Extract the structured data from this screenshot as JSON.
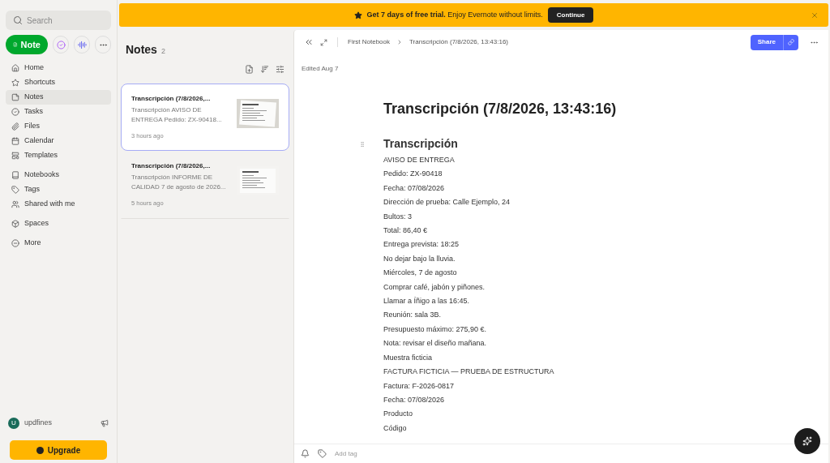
{
  "sidebar": {
    "search": {
      "placeholder": "Search"
    },
    "new_note": "Note",
    "nav_groups": [
      [
        {
          "kind": "home",
          "label": "Home",
          "selected": false
        },
        {
          "kind": "star",
          "label": "Shortcuts",
          "selected": false
        },
        {
          "kind": "note",
          "label": "Notes",
          "selected": true
        },
        {
          "kind": "task",
          "label": "Tasks",
          "selected": false
        },
        {
          "kind": "file",
          "label": "Files",
          "selected": false
        },
        {
          "kind": "calendar",
          "label": "Calendar",
          "selected": false
        },
        {
          "kind": "template",
          "label": "Templates",
          "selected": false
        }
      ],
      [
        {
          "kind": "notebook",
          "label": "Notebooks",
          "selected": false
        },
        {
          "kind": "tag",
          "label": "Tags",
          "selected": false
        },
        {
          "kind": "shared",
          "label": "Shared with me",
          "selected": false
        }
      ],
      [
        {
          "kind": "spaces",
          "label": "Spaces",
          "selected": false
        }
      ],
      [
        {
          "kind": "more",
          "label": "More",
          "selected": false
        }
      ]
    ],
    "user": {
      "initial": "U",
      "name": "updfines"
    },
    "upgrade": "Upgrade"
  },
  "banner": {
    "text": "**Get 7 days of free trial.** Enjoy Evernote without limits.",
    "button": "Continue"
  },
  "notes_list": {
    "title": "Notes",
    "count": "2",
    "notes": [
      {
        "title": "Transcripción (7/8/2026,...",
        "snippet": "Transcripción AVISO DE ENTREGA Pedido: ZX-90418...",
        "time": "3 hours ago",
        "selected": true
      },
      {
        "title": "Transcripción (7/8/2026,...",
        "snippet": "Transcripción INFORME DE CALIDAD 7 de agosto de 2026...",
        "time": "5 hours ago",
        "selected": false
      }
    ]
  },
  "editor": {
    "breadcrumb": [
      "First Notebook",
      "Transcripción (7/8/2026, 13:43:16)"
    ],
    "share": "Share",
    "edited": "Edited Aug 7",
    "title": "Transcripción (7/8/2026, 13:43:16)",
    "heading": "Transcripción",
    "lines": [
      "AVISO DE ENTREGA",
      "Pedido: ZX-90418",
      "Fecha: 07/08/2026",
      "Dirección de prueba: Calle Ejemplo, 24",
      "Bultos: 3",
      "Total: 86,40 €",
      "Entrega prevista: 18:25",
      "No dejar bajo la lluvia.",
      "Miércoles, 7 de agosto",
      "Comprar café, jabón y piñones.",
      "Llamar a Íñigo a las 16:45.",
      "Reunión: sala 3B.",
      "Presupuesto máximo: 275,90 €.",
      "Nota: revisar el diseño mañana.",
      "Muestra ficticia",
      "FACTURA FICTICIA — PRUEBA DE ESTRUCTURA",
      "Factura: F-2026-0817",
      "Fecha: 07/08/2026",
      "Producto",
      "Código"
    ],
    "tag_placeholder": "Add tag"
  }
}
